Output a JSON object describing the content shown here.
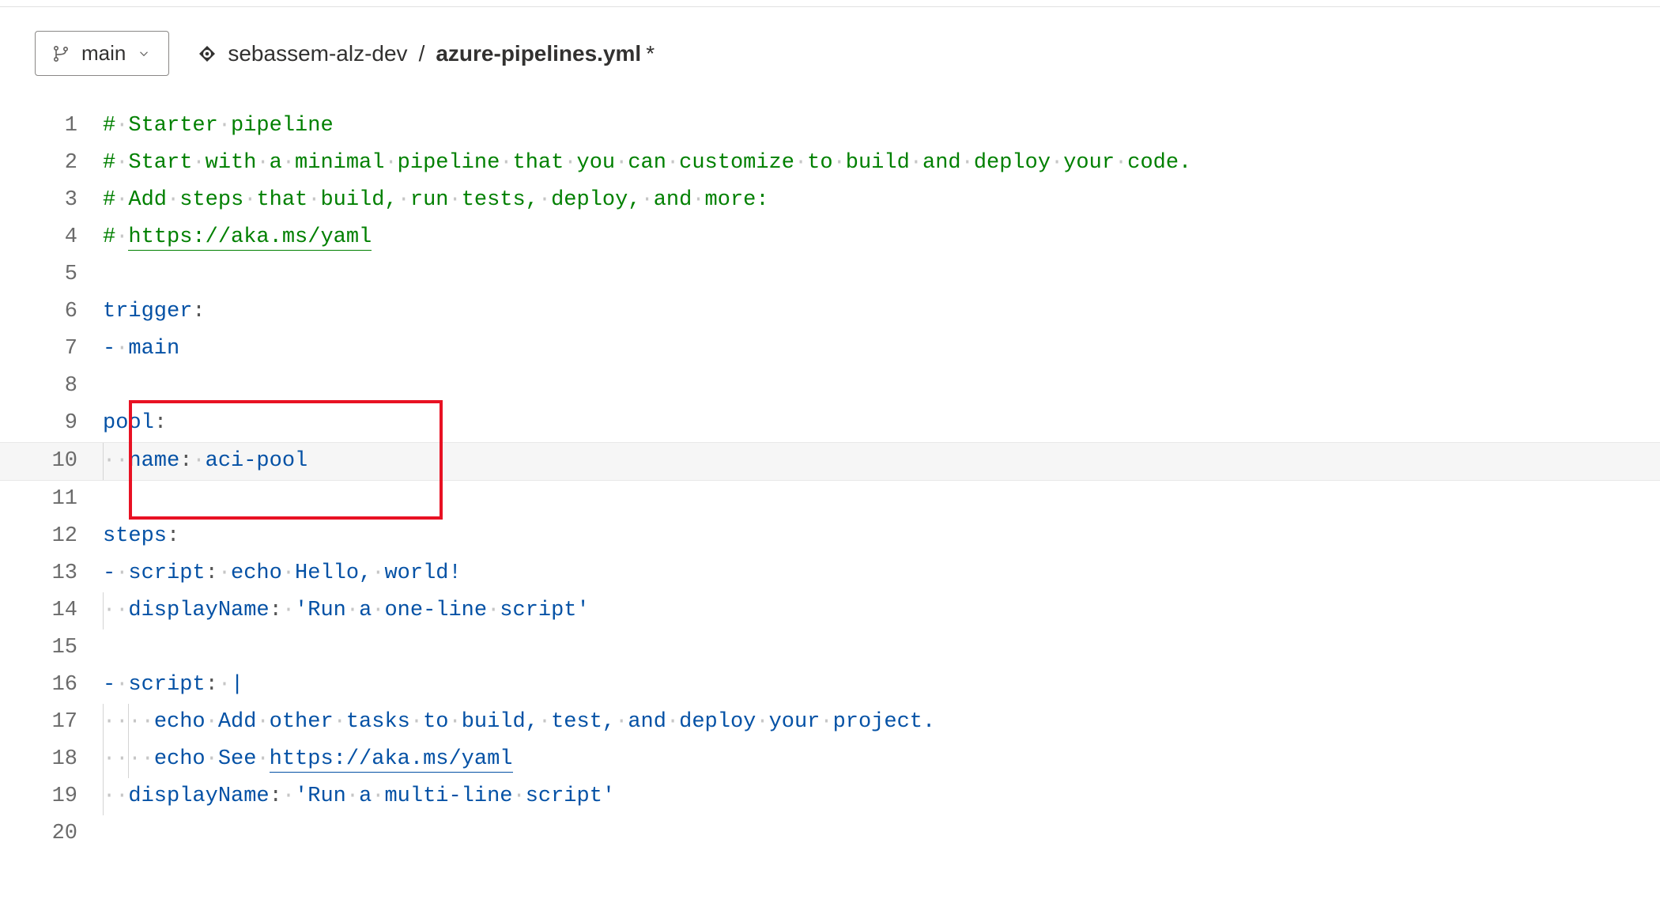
{
  "header": {
    "branch_label": "main",
    "repo_name": "sebassem-alz-dev",
    "file_name": "azure-pipelines.yml",
    "dirty_marker": "*",
    "separator": "/"
  },
  "editor": {
    "current_line": 10,
    "highlight": {
      "from_line": 9,
      "to_line": 11
    },
    "lines": [
      {
        "n": 1,
        "tokens": [
          {
            "t": "comment",
            "v": "#"
          },
          {
            "t": "ws",
            "v": "·"
          },
          {
            "t": "comment",
            "v": "Starter"
          },
          {
            "t": "ws",
            "v": "·"
          },
          {
            "t": "comment",
            "v": "pipeline"
          }
        ]
      },
      {
        "n": 2,
        "tokens": [
          {
            "t": "comment",
            "v": "#"
          },
          {
            "t": "ws",
            "v": "·"
          },
          {
            "t": "comment",
            "v": "Start"
          },
          {
            "t": "ws",
            "v": "·"
          },
          {
            "t": "comment",
            "v": "with"
          },
          {
            "t": "ws",
            "v": "·"
          },
          {
            "t": "comment",
            "v": "a"
          },
          {
            "t": "ws",
            "v": "·"
          },
          {
            "t": "comment",
            "v": "minimal"
          },
          {
            "t": "ws",
            "v": "·"
          },
          {
            "t": "comment",
            "v": "pipeline"
          },
          {
            "t": "ws",
            "v": "·"
          },
          {
            "t": "comment",
            "v": "that"
          },
          {
            "t": "ws",
            "v": "·"
          },
          {
            "t": "comment",
            "v": "you"
          },
          {
            "t": "ws",
            "v": "·"
          },
          {
            "t": "comment",
            "v": "can"
          },
          {
            "t": "ws",
            "v": "·"
          },
          {
            "t": "comment",
            "v": "customize"
          },
          {
            "t": "ws",
            "v": "·"
          },
          {
            "t": "comment",
            "v": "to"
          },
          {
            "t": "ws",
            "v": "·"
          },
          {
            "t": "comment",
            "v": "build"
          },
          {
            "t": "ws",
            "v": "·"
          },
          {
            "t": "comment",
            "v": "and"
          },
          {
            "t": "ws",
            "v": "·"
          },
          {
            "t": "comment",
            "v": "deploy"
          },
          {
            "t": "ws",
            "v": "·"
          },
          {
            "t": "comment",
            "v": "your"
          },
          {
            "t": "ws",
            "v": "·"
          },
          {
            "t": "comment",
            "v": "code."
          }
        ]
      },
      {
        "n": 3,
        "tokens": [
          {
            "t": "comment",
            "v": "#"
          },
          {
            "t": "ws",
            "v": "·"
          },
          {
            "t": "comment",
            "v": "Add"
          },
          {
            "t": "ws",
            "v": "·"
          },
          {
            "t": "comment",
            "v": "steps"
          },
          {
            "t": "ws",
            "v": "·"
          },
          {
            "t": "comment",
            "v": "that"
          },
          {
            "t": "ws",
            "v": "·"
          },
          {
            "t": "comment",
            "v": "build,"
          },
          {
            "t": "ws",
            "v": "·"
          },
          {
            "t": "comment",
            "v": "run"
          },
          {
            "t": "ws",
            "v": "·"
          },
          {
            "t": "comment",
            "v": "tests,"
          },
          {
            "t": "ws",
            "v": "·"
          },
          {
            "t": "comment",
            "v": "deploy,"
          },
          {
            "t": "ws",
            "v": "·"
          },
          {
            "t": "comment",
            "v": "and"
          },
          {
            "t": "ws",
            "v": "·"
          },
          {
            "t": "comment",
            "v": "more:"
          }
        ]
      },
      {
        "n": 4,
        "tokens": [
          {
            "t": "comment",
            "v": "#"
          },
          {
            "t": "ws",
            "v": "·"
          },
          {
            "t": "comment link",
            "v": "https://aka.ms/yaml"
          }
        ]
      },
      {
        "n": 5,
        "tokens": []
      },
      {
        "n": 6,
        "tokens": [
          {
            "t": "key",
            "v": "trigger"
          },
          {
            "t": "punct",
            "v": ":"
          }
        ]
      },
      {
        "n": 7,
        "tokens": [
          {
            "t": "dash",
            "v": "-"
          },
          {
            "t": "ws",
            "v": "·"
          },
          {
            "t": "text",
            "v": "main"
          }
        ]
      },
      {
        "n": 8,
        "tokens": []
      },
      {
        "n": 9,
        "tokens": [
          {
            "t": "key",
            "v": "pool"
          },
          {
            "t": "punct",
            "v": ":"
          }
        ]
      },
      {
        "n": 10,
        "tokens": [
          {
            "t": "guide",
            "v": ""
          },
          {
            "t": "ws",
            "v": "·"
          },
          {
            "t": "ws",
            "v": "·"
          },
          {
            "t": "key",
            "v": "name"
          },
          {
            "t": "punct",
            "v": ":"
          },
          {
            "t": "ws",
            "v": "·"
          },
          {
            "t": "text",
            "v": "aci-pool"
          }
        ]
      },
      {
        "n": 11,
        "tokens": []
      },
      {
        "n": 12,
        "tokens": [
          {
            "t": "key",
            "v": "steps"
          },
          {
            "t": "punct",
            "v": ":"
          }
        ]
      },
      {
        "n": 13,
        "tokens": [
          {
            "t": "dash",
            "v": "-"
          },
          {
            "t": "ws",
            "v": "·"
          },
          {
            "t": "key",
            "v": "script"
          },
          {
            "t": "punct",
            "v": ":"
          },
          {
            "t": "ws",
            "v": "·"
          },
          {
            "t": "text",
            "v": "echo"
          },
          {
            "t": "ws",
            "v": "·"
          },
          {
            "t": "text",
            "v": "Hello,"
          },
          {
            "t": "ws",
            "v": "·"
          },
          {
            "t": "text",
            "v": "world!"
          }
        ]
      },
      {
        "n": 14,
        "tokens": [
          {
            "t": "guide",
            "v": ""
          },
          {
            "t": "ws",
            "v": "·"
          },
          {
            "t": "ws",
            "v": "·"
          },
          {
            "t": "key",
            "v": "displayName"
          },
          {
            "t": "punct",
            "v": ":"
          },
          {
            "t": "ws",
            "v": "·"
          },
          {
            "t": "string",
            "v": "'Run"
          },
          {
            "t": "ws",
            "v": "·"
          },
          {
            "t": "string",
            "v": "a"
          },
          {
            "t": "ws",
            "v": "·"
          },
          {
            "t": "string",
            "v": "one-line"
          },
          {
            "t": "ws",
            "v": "·"
          },
          {
            "t": "string",
            "v": "script'"
          }
        ]
      },
      {
        "n": 15,
        "tokens": []
      },
      {
        "n": 16,
        "tokens": [
          {
            "t": "dash",
            "v": "-"
          },
          {
            "t": "ws",
            "v": "·"
          },
          {
            "t": "key",
            "v": "script"
          },
          {
            "t": "punct",
            "v": ":"
          },
          {
            "t": "ws",
            "v": "·"
          },
          {
            "t": "pipe",
            "v": "|"
          }
        ]
      },
      {
        "n": 17,
        "tokens": [
          {
            "t": "guide",
            "v": ""
          },
          {
            "t": "ws",
            "v": "·"
          },
          {
            "t": "ws",
            "v": "·"
          },
          {
            "t": "guide",
            "v": ""
          },
          {
            "t": "ws",
            "v": "·"
          },
          {
            "t": "ws",
            "v": "·"
          },
          {
            "t": "text",
            "v": "echo"
          },
          {
            "t": "ws",
            "v": "·"
          },
          {
            "t": "text",
            "v": "Add"
          },
          {
            "t": "ws",
            "v": "·"
          },
          {
            "t": "text",
            "v": "other"
          },
          {
            "t": "ws",
            "v": "·"
          },
          {
            "t": "text",
            "v": "tasks"
          },
          {
            "t": "ws",
            "v": "·"
          },
          {
            "t": "text",
            "v": "to"
          },
          {
            "t": "ws",
            "v": "·"
          },
          {
            "t": "text",
            "v": "build,"
          },
          {
            "t": "ws",
            "v": "·"
          },
          {
            "t": "text",
            "v": "test,"
          },
          {
            "t": "ws",
            "v": "·"
          },
          {
            "t": "text",
            "v": "and"
          },
          {
            "t": "ws",
            "v": "·"
          },
          {
            "t": "text",
            "v": "deploy"
          },
          {
            "t": "ws",
            "v": "·"
          },
          {
            "t": "text",
            "v": "your"
          },
          {
            "t": "ws",
            "v": "·"
          },
          {
            "t": "text",
            "v": "project."
          }
        ]
      },
      {
        "n": 18,
        "tokens": [
          {
            "t": "guide",
            "v": ""
          },
          {
            "t": "ws",
            "v": "·"
          },
          {
            "t": "ws",
            "v": "·"
          },
          {
            "t": "guide",
            "v": ""
          },
          {
            "t": "ws",
            "v": "·"
          },
          {
            "t": "ws",
            "v": "·"
          },
          {
            "t": "text",
            "v": "echo"
          },
          {
            "t": "ws",
            "v": "·"
          },
          {
            "t": "text",
            "v": "See"
          },
          {
            "t": "ws",
            "v": "·"
          },
          {
            "t": "text link",
            "v": "https://aka.ms/yaml"
          }
        ]
      },
      {
        "n": 19,
        "tokens": [
          {
            "t": "guide",
            "v": ""
          },
          {
            "t": "ws",
            "v": "·"
          },
          {
            "t": "ws",
            "v": "·"
          },
          {
            "t": "key",
            "v": "displayName"
          },
          {
            "t": "punct",
            "v": ":"
          },
          {
            "t": "ws",
            "v": "·"
          },
          {
            "t": "string",
            "v": "'Run"
          },
          {
            "t": "ws",
            "v": "·"
          },
          {
            "t": "string",
            "v": "a"
          },
          {
            "t": "ws",
            "v": "·"
          },
          {
            "t": "string",
            "v": "multi-line"
          },
          {
            "t": "ws",
            "v": "·"
          },
          {
            "t": "string",
            "v": "script'"
          }
        ]
      },
      {
        "n": 20,
        "tokens": []
      }
    ]
  }
}
